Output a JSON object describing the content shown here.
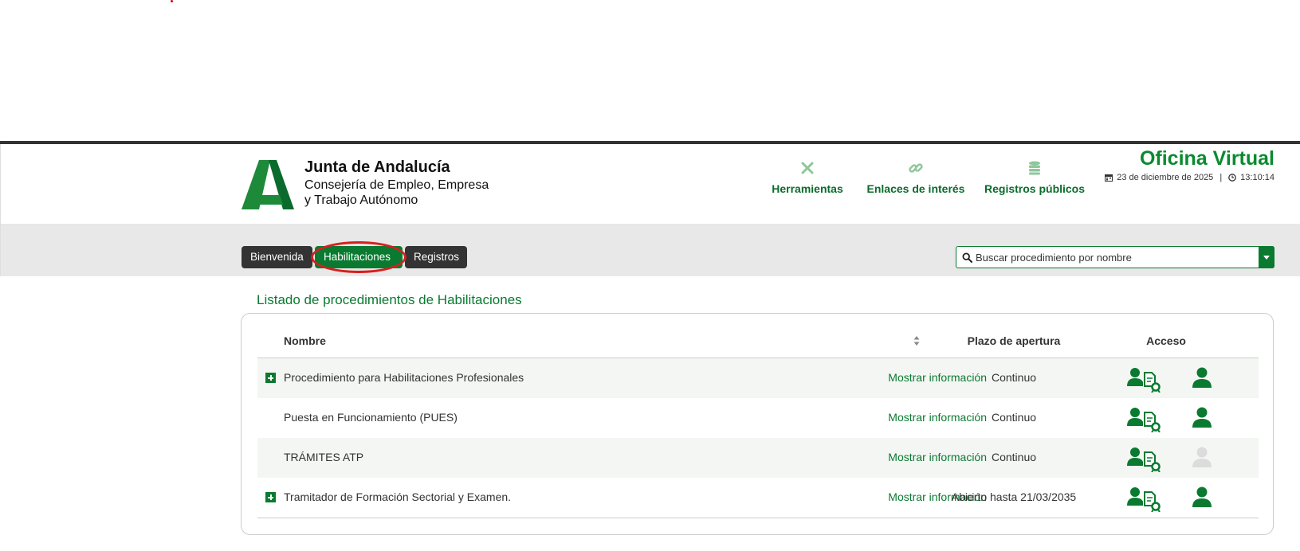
{
  "brand": {
    "title": "Junta de Andalucía",
    "subtitle_line1": "Consejería de Empleo, Empresa",
    "subtitle_line2": "y Trabajo Autónomo"
  },
  "header": {
    "nav": [
      {
        "label": "Herramientas",
        "icon": "tools-icon"
      },
      {
        "label": "Enlaces de interés",
        "icon": "link-icon"
      },
      {
        "label": "Registros públicos",
        "icon": "database-icon"
      }
    ],
    "office_title": "Oficina Virtual",
    "date": "23 de diciembre de 2025",
    "time": "13:10:14"
  },
  "tabs": [
    {
      "label": "Bienvenida",
      "active": false
    },
    {
      "label": "Habilitaciones",
      "active": true
    },
    {
      "label": "Registros",
      "active": false
    }
  ],
  "search": {
    "placeholder": "Buscar procedimiento por nombre",
    "value": ""
  },
  "list": {
    "title": "Listado de procedimientos de Habilitaciones",
    "columns": {
      "name": "Nombre",
      "plazo": "Plazo de apertura",
      "acceso": "Acceso"
    },
    "rows": [
      {
        "name": "Procedimiento para Habilitaciones Profesionales",
        "info": "Mostrar información",
        "plazo": "Continuo",
        "expandable": true,
        "user_enabled": true
      },
      {
        "name": "Puesta en Funcionamiento (PUES)",
        "info": "Mostrar información",
        "plazo": "Continuo",
        "expandable": false,
        "user_enabled": true
      },
      {
        "name": "TRÁMITES ATP",
        "info": "Mostrar información",
        "plazo": "Continuo",
        "expandable": false,
        "user_enabled": false
      },
      {
        "name": "Tramitador de Formación Sectorial y Examen.",
        "info": "Mostrar información",
        "plazo": "Abierto hasta 21/03/2035",
        "expandable": true,
        "user_enabled": true
      }
    ]
  },
  "colors": {
    "brand_green": "#0a7a30",
    "title_green": "#0a8a2f",
    "disabled_gray": "#dcdcdc",
    "highlight_red": "#d81e1e"
  }
}
